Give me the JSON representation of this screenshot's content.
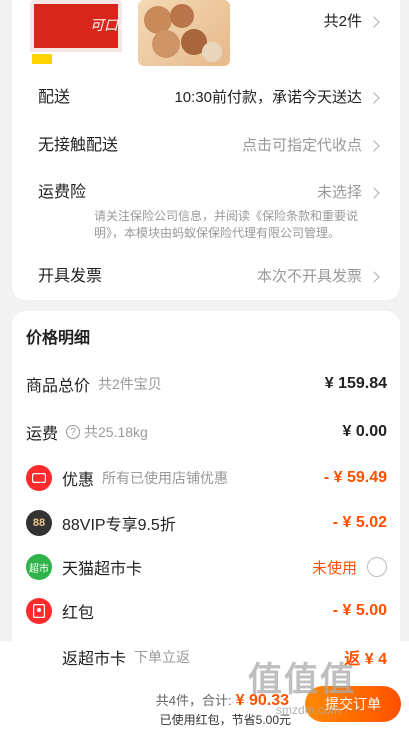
{
  "items": {
    "count_label": "共2件"
  },
  "delivery": {
    "label": "配送",
    "value": "10:30前付款，承诺今天送达"
  },
  "contactless": {
    "label": "无接触配送",
    "value": "点击可指定代收点"
  },
  "shipping_insurance": {
    "label": "运费险",
    "value": "未选择",
    "notice": "请关注保险公司信息，并阅读《保险条款和重要说明》，本模块由蚂蚁保保险代理有限公司管理。"
  },
  "invoice": {
    "label": "开具发票",
    "value": "本次不开具发票"
  },
  "price_detail": {
    "title": "价格明细",
    "goods_total": {
      "label": "商品总价",
      "sub": "共2件宝贝",
      "amount": "¥ 159.84"
    },
    "freight": {
      "label": "运费",
      "sub": "共25.18kg",
      "amount": "¥ 0.00"
    },
    "discount": {
      "label": "优惠",
      "sub": "所有已使用店铺优惠",
      "amount": "- ¥ 59.49"
    },
    "vip": {
      "label": "88VIP专享9.5折",
      "icon_text": "88",
      "amount": "- ¥ 5.02"
    },
    "tmall_card": {
      "label": "天猫超市卡",
      "icon_text": "超市",
      "status": "未使用"
    },
    "red_packet": {
      "label": "红包",
      "amount": "- ¥ 5.00"
    },
    "return_card": {
      "label": "返超市卡",
      "sub": "下单立返",
      "amount": "返 ¥ 4"
    }
  },
  "bottom_bar": {
    "summary": "共4件，合计:",
    "total": "¥ 90.33",
    "saved": "已使用红包，节省5.00元",
    "submit_label": "提交订单"
  },
  "watermark": {
    "text": "值值值",
    "sub": "smzdm.com"
  },
  "colors": {
    "accent": "#ff5000",
    "red": "#ff2a2a",
    "green": "#2fb34a"
  },
  "icons": [
    "chevron-right-icon",
    "coupon-icon",
    "vip-88-icon",
    "supermarket-card-icon",
    "red-packet-icon",
    "question-icon"
  ]
}
